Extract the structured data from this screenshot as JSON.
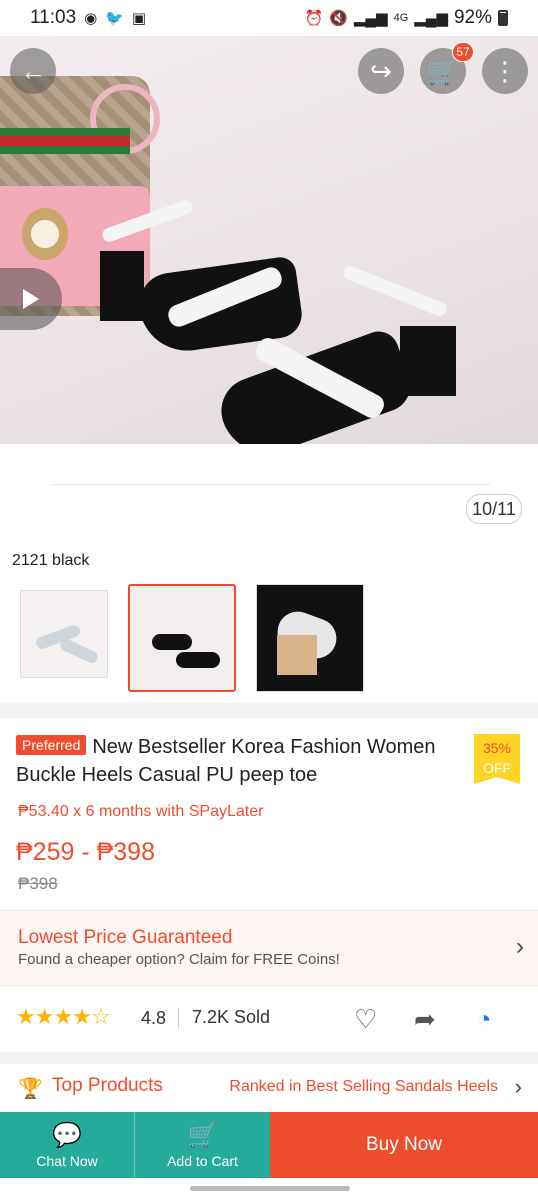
{
  "status_bar": {
    "time": "11:03",
    "network": "4G",
    "battery": "92%"
  },
  "gallery": {
    "cart_count": "57",
    "counter": "10/11"
  },
  "variation": {
    "selected_label": "2121 black"
  },
  "product": {
    "preferred_badge": "Preferred",
    "title": "New Bestseller Korea Fashion Women Buckle Heels Casual PU peep toe",
    "discount_percent": "35%",
    "discount_off": "OFF",
    "spaylater": "₱53.40 x 6 months with SPayLater",
    "price_range": "₱259 - ₱398",
    "original_price": "₱398"
  },
  "guarantee": {
    "title": "Lowest Price Guaranteed",
    "subtitle": "Found a cheaper option? Claim for FREE Coins!"
  },
  "rating": {
    "stars": 4.8,
    "value": "4.8",
    "sold": "7.2K Sold"
  },
  "top_products": {
    "title": "Top Products",
    "rank_text": "Ranked in Best Selling Sandals Heels"
  },
  "bottom_bar": {
    "chat_label": "Chat Now",
    "cart_label": "Add to Cart",
    "buy_label": "Buy Now"
  },
  "colors": {
    "brand": "#ee4d2d",
    "teal": "#26aa99",
    "star": "#ffb400"
  }
}
